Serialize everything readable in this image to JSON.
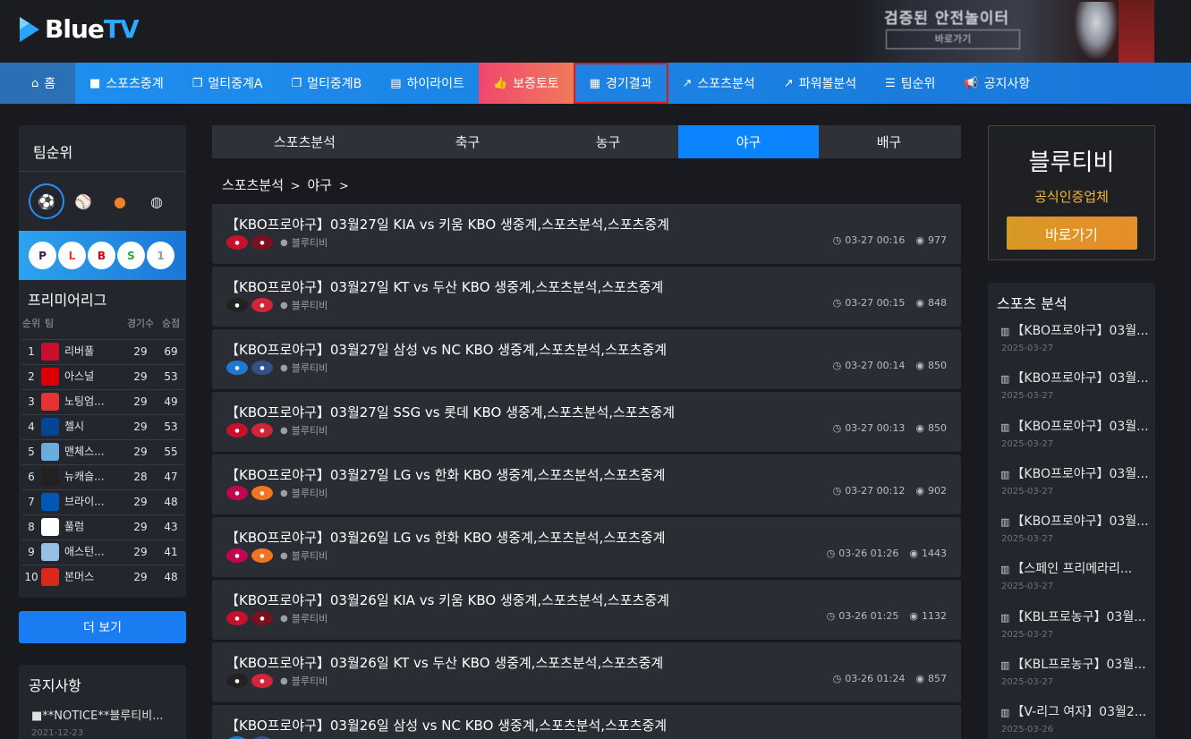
{
  "brand": {
    "name_blue": "Blue",
    "name_tv": "TV"
  },
  "banner": {
    "line1": "검증된 안전놀이터",
    "button": "바로가기"
  },
  "nav": [
    {
      "icon": "⌂",
      "label": "홈"
    },
    {
      "icon": "■",
      "label": "스포츠중계"
    },
    {
      "icon": "❐",
      "label": "멀티중계A"
    },
    {
      "icon": "❐",
      "label": "멀티중계B"
    },
    {
      "icon": "▤",
      "label": "하이라이트"
    },
    {
      "icon": "👍",
      "label": "보증토토"
    },
    {
      "icon": "▦",
      "label": "경기결과"
    },
    {
      "icon": "↗",
      "label": "스포츠분석"
    },
    {
      "icon": "↗",
      "label": "파워볼분석"
    },
    {
      "icon": "☰",
      "label": "팀순위"
    },
    {
      "icon": "📢",
      "label": "공지사항"
    }
  ],
  "standings": {
    "title": "팀순위",
    "league": "프리미어리그",
    "headers": {
      "rank": "순위",
      "team": "팀",
      "played": "경기수",
      "points": "승점"
    },
    "rows": [
      {
        "rank": "1",
        "team": "리버풀",
        "played": "29",
        "points": "69",
        "color": "#c8102e"
      },
      {
        "rank": "2",
        "team": "아스널",
        "played": "29",
        "points": "53",
        "color": "#db0007"
      },
      {
        "rank": "3",
        "team": "노팅엄...",
        "played": "29",
        "points": "49",
        "color": "#e53233"
      },
      {
        "rank": "4",
        "team": "첼시",
        "played": "29",
        "points": "53",
        "color": "#034694"
      },
      {
        "rank": "5",
        "team": "맨체스...",
        "played": "29",
        "points": "55",
        "color": "#6cabdd"
      },
      {
        "rank": "6",
        "team": "뉴캐슬...",
        "played": "28",
        "points": "47",
        "color": "#241f20"
      },
      {
        "rank": "7",
        "team": "브라이...",
        "played": "29",
        "points": "48",
        "color": "#0057b8"
      },
      {
        "rank": "8",
        "team": "풀럼",
        "played": "29",
        "points": "43",
        "color": "#ffffff"
      },
      {
        "rank": "9",
        "team": "애스턴...",
        "played": "29",
        "points": "41",
        "color": "#95bfe5"
      },
      {
        "rank": "10",
        "team": "본머스",
        "played": "29",
        "points": "48",
        "color": "#da291c"
      }
    ],
    "more": "더 보기"
  },
  "notice": {
    "title": "공지사항",
    "item": "**NOTICE**블루티비...",
    "date": "2021-12-23"
  },
  "tabs": [
    "스포츠분석",
    "축구",
    "농구",
    "야구",
    "배구"
  ],
  "breadcrumb": {
    "root": "스포츠분석",
    "sep1": ">",
    "current": "야구",
    "sep2": ">"
  },
  "author": "블루티비",
  "posts": [
    {
      "title": "【KBO프로야구】03월27일 KIA vs 키움 KBO 생중계,스포츠분석,스포츠중계",
      "date": "03-27 00:16",
      "views": "977",
      "t1": "#c8102e",
      "t2": "#7a1020"
    },
    {
      "title": "【KBO프로야구】03월27일 KT vs 두산 KBO 생중계,스포츠분석,스포츠중계",
      "date": "03-27 00:15",
      "views": "848",
      "t1": "#222",
      "t2": "#d3243a"
    },
    {
      "title": "【KBO프로야구】03월27일 삼성 vs NC KBO 생중계,스포츠분석,스포츠중계",
      "date": "03-27 00:14",
      "views": "850",
      "t1": "#1f78d1",
      "t2": "#315288"
    },
    {
      "title": "【KBO프로야구】03월27일 SSG vs 롯데 KBO 생중계,스포츠분석,스포츠중계",
      "date": "03-27 00:13",
      "views": "850",
      "t1": "#c8102e",
      "t2": "#d3243a"
    },
    {
      "title": "【KBO프로야구】03월27일 LG vs 한화 KBO 생중계,스포츠분석,스포츠중계",
      "date": "03-27 00:12",
      "views": "902",
      "t1": "#c30452",
      "t2": "#f37321"
    },
    {
      "title": "【KBO프로야구】03월26일 LG vs 한화 KBO 생중계,스포츠분석,스포츠중계",
      "date": "03-26 01:26",
      "views": "1443",
      "t1": "#c30452",
      "t2": "#f37321"
    },
    {
      "title": "【KBO프로야구】03월26일 KIA vs 키움 KBO 생중계,스포츠분석,스포츠중계",
      "date": "03-26 01:25",
      "views": "1132",
      "t1": "#c8102e",
      "t2": "#7a1020"
    },
    {
      "title": "【KBO프로야구】03월26일 KT vs 두산 KBO 생중계,스포츠분석,스포츠중계",
      "date": "03-26 01:24",
      "views": "857",
      "t1": "#222",
      "t2": "#d3243a"
    },
    {
      "title": "【KBO프로야구】03월26일 삼성 vs NC KBO 생중계,스포츠분석,스포츠중계",
      "date": "",
      "views": "",
      "t1": "#1f78d1",
      "t2": "#315288"
    }
  ],
  "promo": {
    "title": "블루티비",
    "subtitle": "공식인증업체",
    "button": "바로가기"
  },
  "analysis": {
    "title": "스포츠 분석",
    "items": [
      {
        "text": "【KBO프로야구】03월...",
        "date": "2025-03-27"
      },
      {
        "text": "【KBO프로야구】03월...",
        "date": "2025-03-27"
      },
      {
        "text": "【KBO프로야구】03월...",
        "date": "2025-03-27"
      },
      {
        "text": "【KBO프로야구】03월...",
        "date": "2025-03-27"
      },
      {
        "text": "【KBO프로야구】03월...",
        "date": "2025-03-27"
      },
      {
        "text": "【스페인 프리메라리...",
        "date": "2025-03-27"
      },
      {
        "text": "【KBL프로농구】03월...",
        "date": "2025-03-27"
      },
      {
        "text": "【KBL프로농구】03월...",
        "date": "2025-03-27"
      },
      {
        "text": "【V-리그 여자】03월2...",
        "date": "2025-03-26"
      }
    ]
  }
}
